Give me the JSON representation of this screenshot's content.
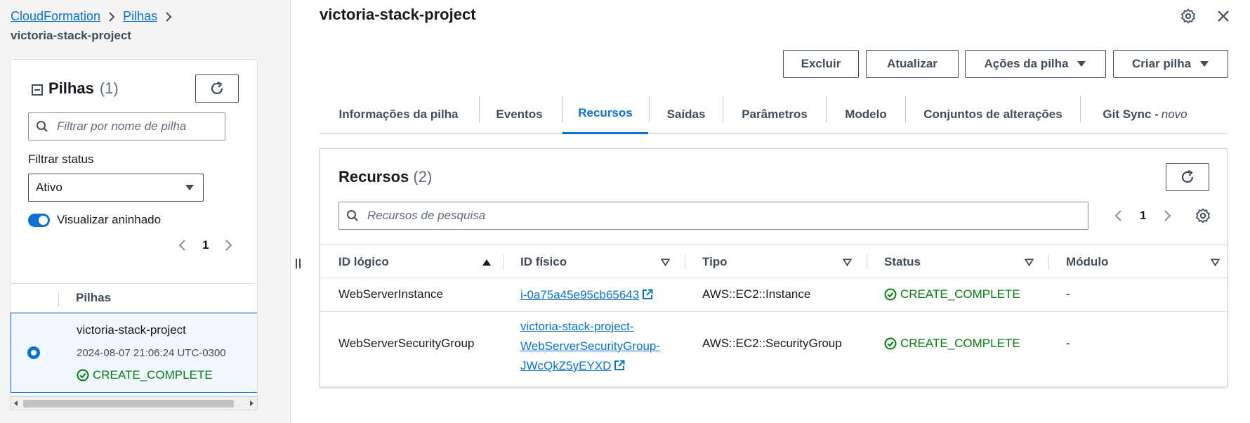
{
  "breadcrumb": {
    "items": [
      "CloudFormation",
      "Pilhas"
    ],
    "current": "victoria-stack-project"
  },
  "stacks_panel": {
    "title": "Pilhas",
    "count": "(1)",
    "search_placeholder": "Filtrar por nome de pilha",
    "filter_status_label": "Filtrar status",
    "filter_status_value": "Ativo",
    "nested_toggle_label": "Visualizar aninhado",
    "nested_toggle_on": true,
    "page": "1",
    "column_header": "Pilhas",
    "rows": [
      {
        "name": "victoria-stack-project",
        "date": "2024-08-07 21:06:24 UTC-0300",
        "status": "CREATE_COMPLETE"
      }
    ]
  },
  "stack_detail": {
    "title": "victoria-stack-project",
    "actions": {
      "delete": "Excluir",
      "update": "Atualizar",
      "stack_actions": "Ações da pilha",
      "create_stack": "Criar pilha"
    },
    "tabs": [
      {
        "label": "Informações da pilha"
      },
      {
        "label": "Eventos"
      },
      {
        "label": "Recursos"
      },
      {
        "label": "Saídas"
      },
      {
        "label": "Parâmetros"
      },
      {
        "label": "Modelo"
      },
      {
        "label": "Conjuntos de alterações"
      },
      {
        "label": "Git Sync - ",
        "suffix": "novo"
      }
    ],
    "active_tab": "Recursos"
  },
  "resources": {
    "title": "Recursos",
    "count": "(2)",
    "search_placeholder": "Recursos de pesquisa",
    "page": "1",
    "columns": [
      "ID lógico",
      "ID físico",
      "Tipo",
      "Status",
      "Módulo"
    ],
    "rows": [
      {
        "logical_id": "WebServerInstance",
        "physical_id": "i-0a75a45e95cb65643",
        "type": "AWS::EC2::Instance",
        "status": "CREATE_COMPLETE",
        "module": "-"
      },
      {
        "logical_id": "WebServerSecurityGroup",
        "physical_id_lines": [
          "victoria-stack-project-",
          "WebServerSecurityGroup-",
          "JWcQkZ5yEYXD"
        ],
        "type": "AWS::EC2::SecurityGroup",
        "status": "CREATE_COMPLETE",
        "module": "-"
      }
    ]
  },
  "colors": {
    "link": "#0972d3",
    "success": "#037f0c",
    "text": "#16191f",
    "selected_bg": "#f1f8ff"
  },
  "icons": {
    "breadcrumb_separator": "chevron-right-icon",
    "refresh": "refresh-icon",
    "search": "search-icon",
    "settings": "gear-icon",
    "close": "close-icon",
    "external": "external-link-icon",
    "status_ok": "check-circle-icon"
  }
}
